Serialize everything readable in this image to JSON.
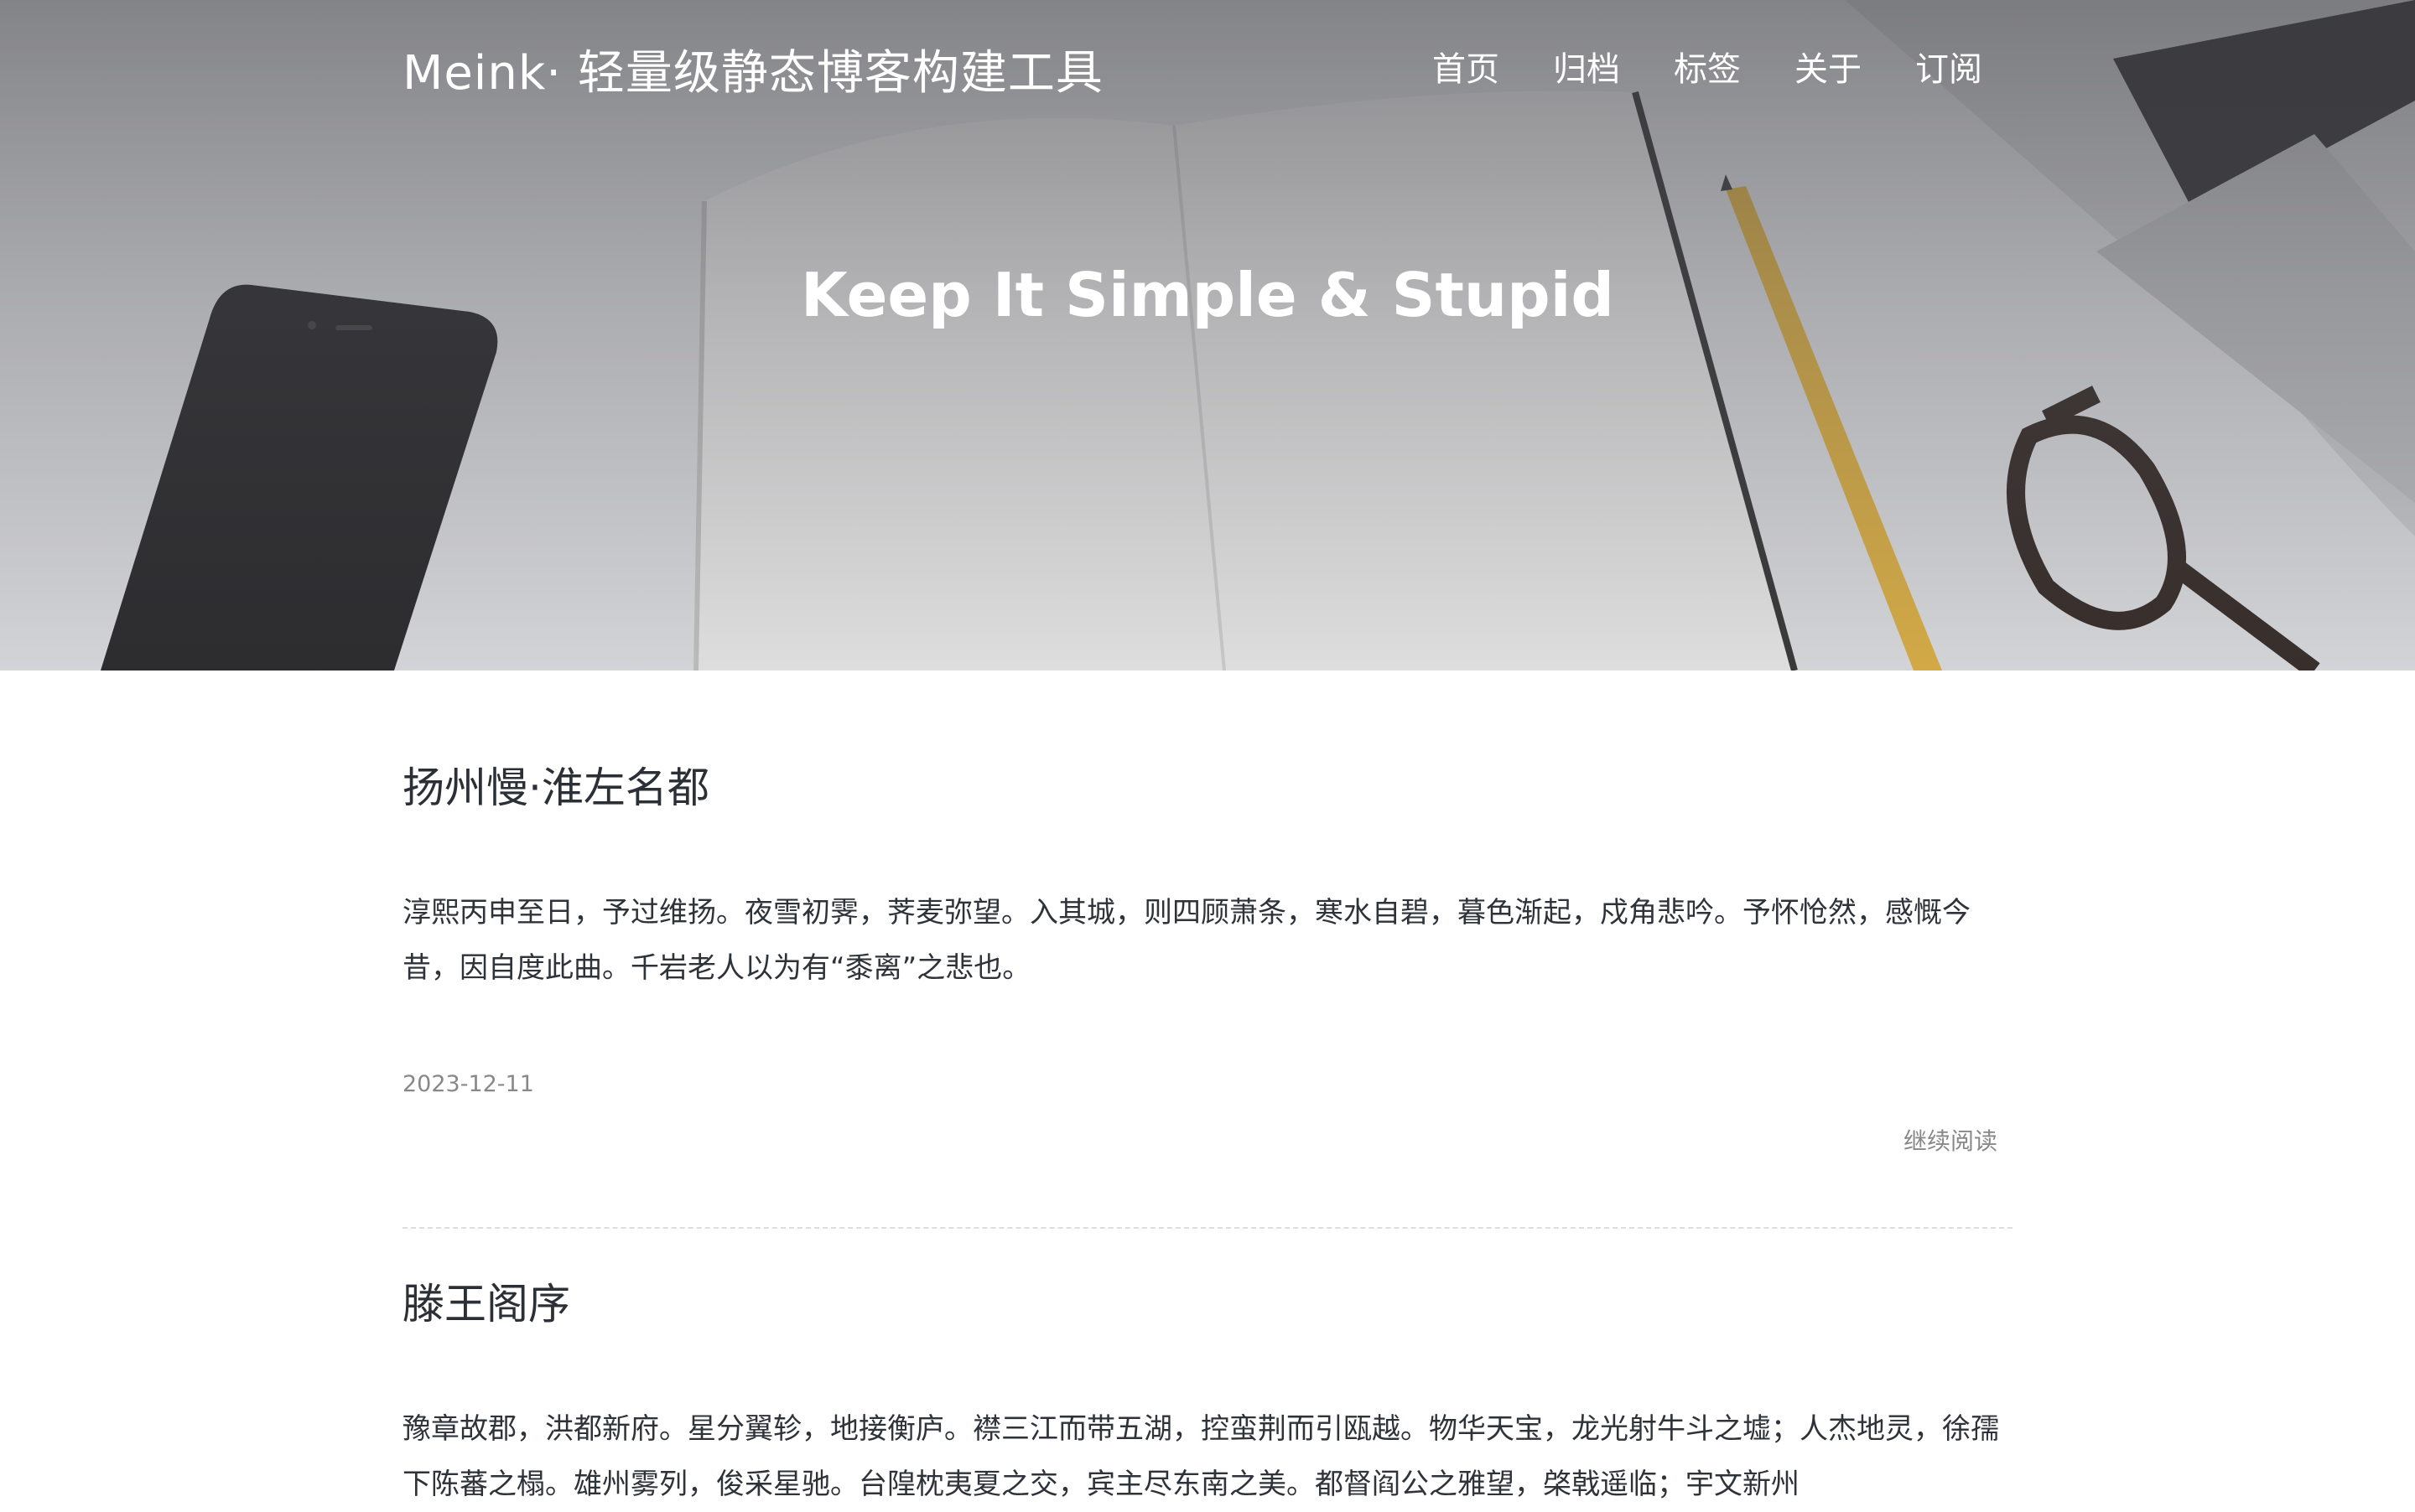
{
  "navbar": {
    "brand": "Meink· 轻量级静态博客构建工具",
    "links": [
      "首页",
      "归档",
      "标签",
      "关于",
      "订阅"
    ]
  },
  "hero": {
    "title": "Keep It Simple & Stupid"
  },
  "posts": [
    {
      "title": "扬州慢·淮左名都",
      "excerpt": "淳熙丙申至日，予过维扬。夜雪初霁，荠麦弥望。入其城，则四顾萧条，寒水自碧，暮色渐起，戍角悲吟。予怀怆然，感慨今昔，因自度此曲。千岩老人以为有“黍离”之悲也。",
      "date": "2023-12-11",
      "read_more": "继续阅读"
    },
    {
      "title": "滕王阁序",
      "excerpt": "豫章故郡，洪都新府。星分翼轸，地接衡庐。襟三江而带五湖，控蛮荆而引瓯越。物华天宝，龙光射牛斗之墟；人杰地灵，徐孺下陈蕃之榻。雄州雾列，俊采星驰。台隍枕夷夏之交，宾主尽东南之美。都督阎公之雅望，棨戟遥临；宇文新州"
    }
  ]
}
